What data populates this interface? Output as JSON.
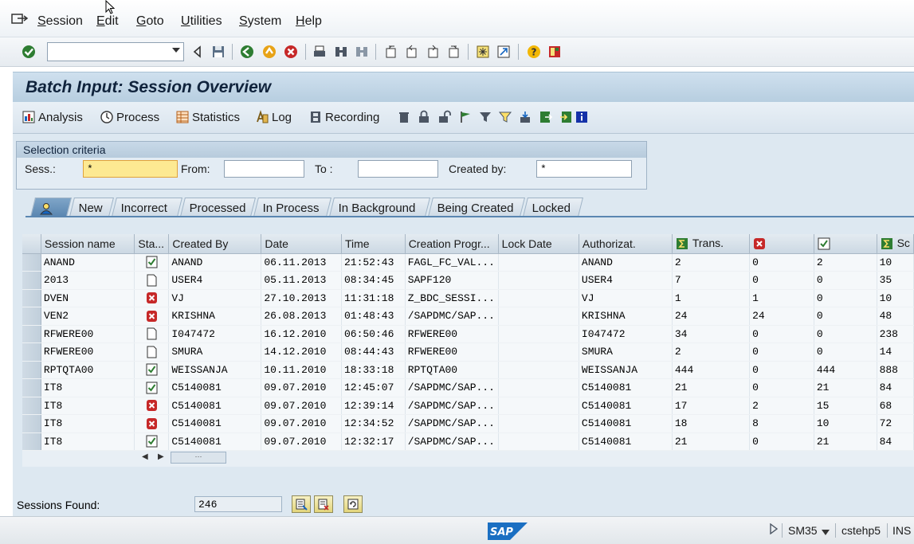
{
  "menubar": {
    "items": [
      {
        "label": "Session",
        "u": "S",
        "rest": "ession"
      },
      {
        "label": "Edit",
        "u": "E",
        "rest": "dit"
      },
      {
        "label": "Goto",
        "u": "G",
        "rest": "oto"
      },
      {
        "label": "Utilities",
        "u": "U",
        "rest": "tilities"
      },
      {
        "label": "System",
        "u": "S",
        "rest": "ystem"
      },
      {
        "label": "Help",
        "u": "H",
        "rest": "elp"
      }
    ]
  },
  "toolbar": {
    "command_field": {
      "value": "",
      "placeholder": ""
    }
  },
  "title": "Batch Input: Session Overview",
  "appbar": {
    "analysis": "Analysis",
    "process": "Process",
    "statistics": "Statistics",
    "log": "Log",
    "recording": "Recording"
  },
  "selection": {
    "header": "Selection criteria",
    "sess_label": "Sess.:",
    "sess_value": "*",
    "from_label": "From:",
    "from_value": "",
    "to_label": "To :",
    "to_value": "",
    "created_by_label": "Created by:",
    "created_by_value": "*"
  },
  "tabs": [
    "New",
    "Incorrect",
    "Processed",
    "In Process",
    "In Background",
    "Being Created",
    "Locked"
  ],
  "table": {
    "headers": {
      "session_name": "Session name",
      "status": "Sta...",
      "created_by": "Created By",
      "date": "Date",
      "time": "Time",
      "creation_prog": "Creation Progr...",
      "lock_date": "Lock Date",
      "authorization": "Authorizat.",
      "trans": "Trans.",
      "errors": "",
      "processed": "",
      "screens": "Sc"
    },
    "rows": [
      {
        "name": "ANAND",
        "status": "processed",
        "created_by": "ANAND",
        "date": "06.11.2013",
        "time": "21:52:43",
        "prog": "FAGL_FC_VAL...",
        "lock": "",
        "auth": "ANAND",
        "trans": "2",
        "err": "0",
        "proc": "2",
        "screens": "10"
      },
      {
        "name": "2013",
        "status": "new",
        "created_by": "USER4",
        "date": "05.11.2013",
        "time": "08:34:45",
        "prog": "SAPF120",
        "lock": "",
        "auth": "USER4",
        "trans": "7",
        "err": "0",
        "proc": "0",
        "screens": "35"
      },
      {
        "name": "DVEN",
        "status": "error",
        "created_by": "VJ",
        "date": "27.10.2013",
        "time": "11:31:18",
        "prog": "Z_BDC_SESSI...",
        "lock": "",
        "auth": "VJ",
        "trans": "1",
        "err": "1",
        "proc": "0",
        "screens": "10"
      },
      {
        "name": "VEN2",
        "status": "error",
        "created_by": "KRISHNA",
        "date": "26.08.2013",
        "time": "01:48:43",
        "prog": "/SAPDMC/SAP...",
        "lock": "",
        "auth": "KRISHNA",
        "trans": "24",
        "err": "24",
        "proc": "0",
        "screens": "48"
      },
      {
        "name": "RFWERE00",
        "status": "new",
        "created_by": "I047472",
        "date": "16.12.2010",
        "time": "06:50:46",
        "prog": "RFWERE00",
        "lock": "",
        "auth": "I047472",
        "trans": "34",
        "err": "0",
        "proc": "0",
        "screens": "238"
      },
      {
        "name": "RFWERE00",
        "status": "new",
        "created_by": "SMURA",
        "date": "14.12.2010",
        "time": "08:44:43",
        "prog": "RFWERE00",
        "lock": "",
        "auth": "SMURA",
        "trans": "2",
        "err": "0",
        "proc": "0",
        "screens": "14"
      },
      {
        "name": "RPTQTA00",
        "status": "processed",
        "created_by": "WEISSANJA",
        "date": "10.11.2010",
        "time": "18:33:18",
        "prog": "RPTQTA00",
        "lock": "",
        "auth": "WEISSANJA",
        "trans": "444",
        "err": "0",
        "proc": "444",
        "screens": "888"
      },
      {
        "name": "IT8",
        "status": "processed",
        "created_by": "C5140081",
        "date": "09.07.2010",
        "time": "12:45:07",
        "prog": "/SAPDMC/SAP...",
        "lock": "",
        "auth": "C5140081",
        "trans": "21",
        "err": "0",
        "proc": "21",
        "screens": "84"
      },
      {
        "name": "IT8",
        "status": "error",
        "created_by": "C5140081",
        "date": "09.07.2010",
        "time": "12:39:14",
        "prog": "/SAPDMC/SAP...",
        "lock": "",
        "auth": "C5140081",
        "trans": "17",
        "err": "2",
        "proc": "15",
        "screens": "68"
      },
      {
        "name": "IT8",
        "status": "error",
        "created_by": "C5140081",
        "date": "09.07.2010",
        "time": "12:34:52",
        "prog": "/SAPDMC/SAP...",
        "lock": "",
        "auth": "C5140081",
        "trans": "18",
        "err": "8",
        "proc": "10",
        "screens": "72"
      },
      {
        "name": "IT8",
        "status": "processed",
        "created_by": "C5140081",
        "date": "09.07.2010",
        "time": "12:32:17",
        "prog": "/SAPDMC/SAP...",
        "lock": "",
        "auth": "C5140081",
        "trans": "21",
        "err": "0",
        "proc": "21",
        "screens": "84"
      }
    ]
  },
  "footer": {
    "sessions_found_label": "Sessions Found:",
    "sessions_found_value": "246"
  },
  "statusbar": {
    "tcode": "SM35",
    "server": "cstehp5",
    "mode": "INS"
  }
}
